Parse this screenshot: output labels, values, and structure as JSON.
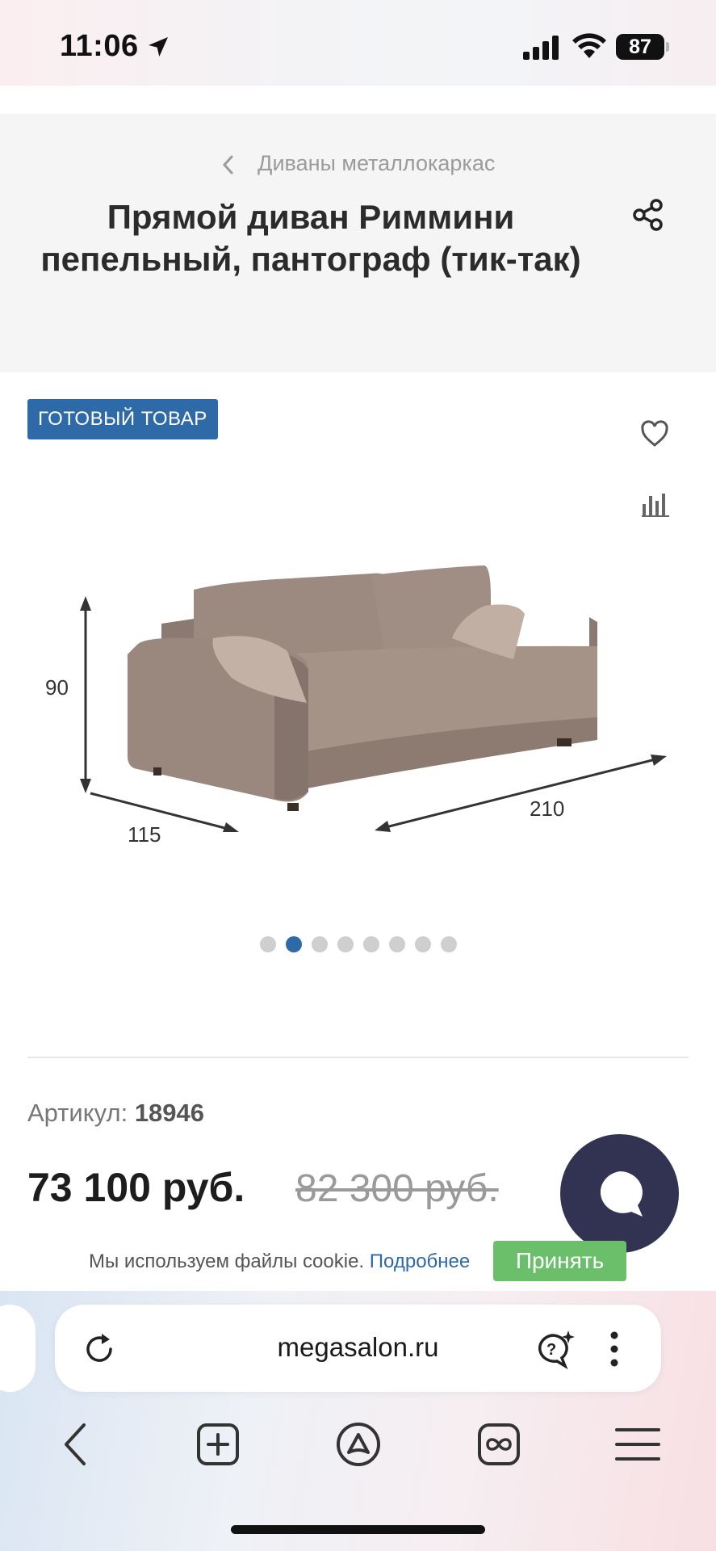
{
  "status_bar": {
    "time": "11:06",
    "battery": "87"
  },
  "breadcrumb": {
    "label": "Диваны металлокаркас"
  },
  "product": {
    "title": "Прямой диван Риммини пепельный, пантограф (тик-так)",
    "badge": "ГОТОВЫЙ ТОВАР",
    "dimensions": {
      "height": "90",
      "depth": "115",
      "width": "210"
    },
    "gallery": {
      "total": 8,
      "active_index": 2
    },
    "sku_label": "Артикул:",
    "sku_value": "18946",
    "price_current": "73 100 руб.",
    "price_old": "82 300 руб."
  },
  "cookie": {
    "text": "Мы используем файлы cookie.",
    "link": "Подробнее",
    "accept": "Принять"
  },
  "browser": {
    "url": "megasalon.ru"
  },
  "colors": {
    "accent": "#2f6aa8",
    "accept_green": "#6cbf6a",
    "chat_bubble": "#323252"
  }
}
